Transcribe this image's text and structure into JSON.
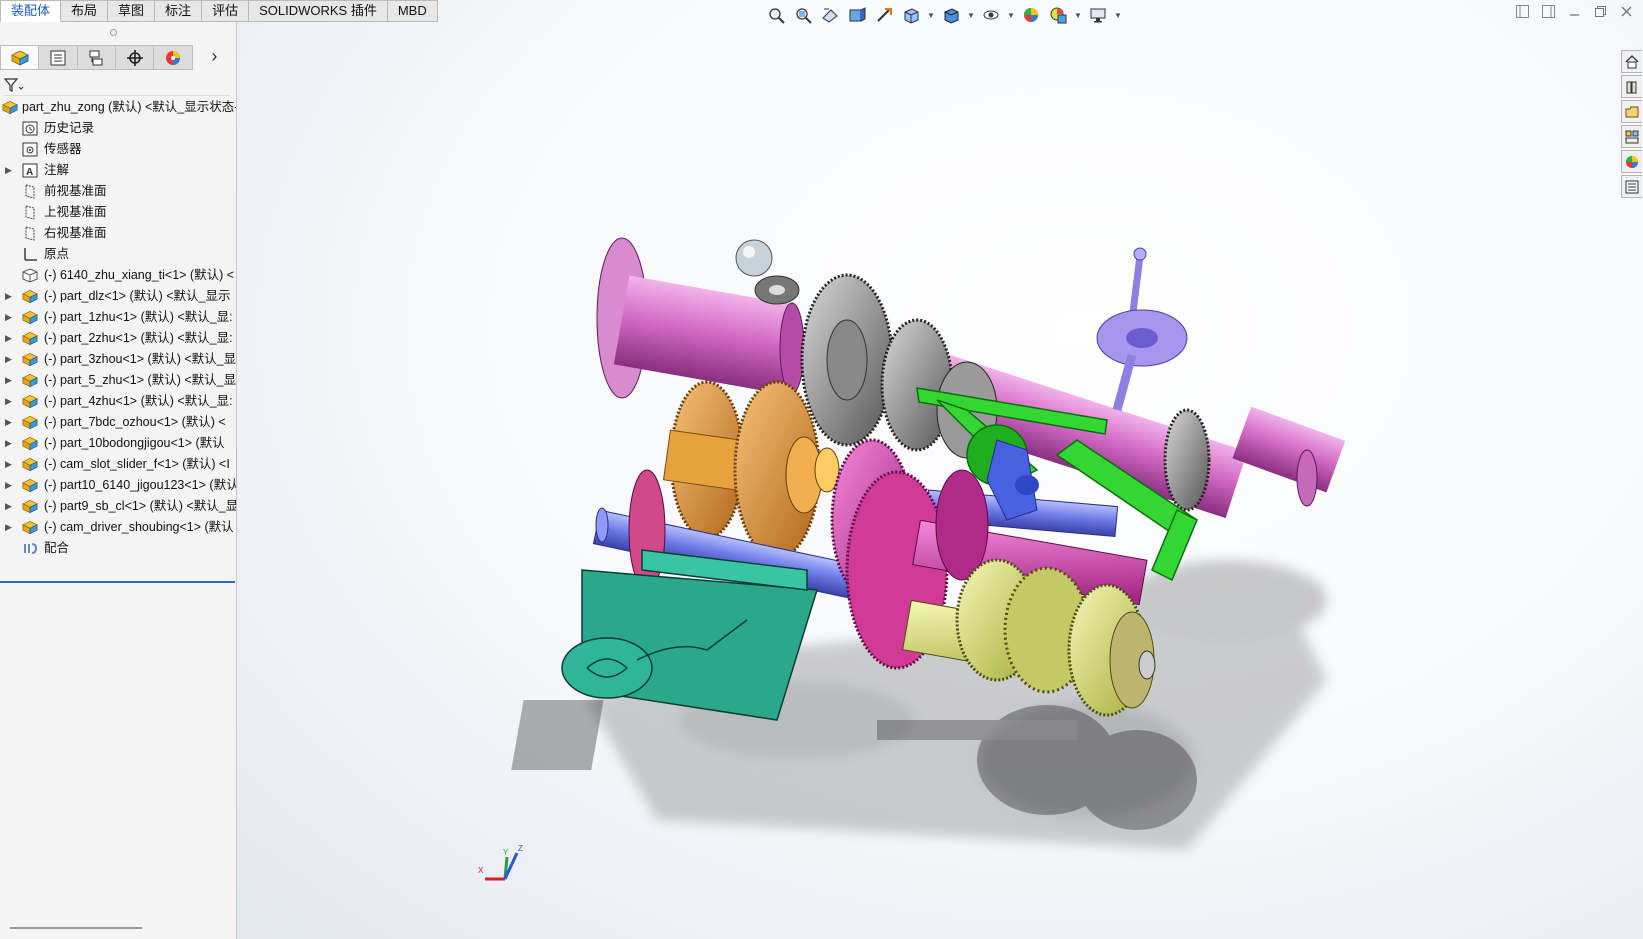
{
  "tabs": [
    "装配体",
    "布局",
    "草图",
    "标注",
    "评估",
    "SOLIDWORKS 插件",
    "MBD"
  ],
  "active_tab": "装配体",
  "manager_tabs": [
    "feature-manager",
    "property-manager",
    "configuration-manager",
    "dimxpert-manager",
    "display-manager"
  ],
  "tree": {
    "root": "part_zhu_zong  (默认) <默认_显示状态-",
    "items": [
      {
        "label": "历史记录",
        "icon": "history-icon",
        "expand": false
      },
      {
        "label": "传感器",
        "icon": "sensor-icon",
        "expand": false
      },
      {
        "label": "注解",
        "icon": "annotation-icon",
        "expand": true
      },
      {
        "label": "前视基准面",
        "icon": "plane-icon",
        "expand": false
      },
      {
        "label": "上视基准面",
        "icon": "plane-icon",
        "expand": false
      },
      {
        "label": "右视基准面",
        "icon": "plane-icon",
        "expand": false
      },
      {
        "label": "原点",
        "icon": "origin-icon",
        "expand": false
      },
      {
        "label": "(-) 6140_zhu_xiang_ti<1> (默认) <",
        "icon": "part-icon",
        "expand": false
      },
      {
        "label": "(-) part_dlz<1> (默认) <默认_显示",
        "icon": "subassembly-icon",
        "expand": true
      },
      {
        "label": "(-) part_1zhu<1> (默认) <默认_显:",
        "icon": "subassembly-icon",
        "expand": true
      },
      {
        "label": "(-) part_2zhu<1> (默认) <默认_显:",
        "icon": "subassembly-icon",
        "expand": true
      },
      {
        "label": "(-) part_3zhou<1> (默认) <默认_显",
        "icon": "subassembly-icon",
        "expand": true
      },
      {
        "label": "(-) part_5_zhu<1> (默认) <默认_显",
        "icon": "subassembly-icon",
        "expand": true
      },
      {
        "label": "(-) part_4zhu<1> (默认) <默认_显:",
        "icon": "subassembly-icon",
        "expand": true
      },
      {
        "label": "(-) part_7bdc_ozhou<1> (默认) <",
        "icon": "subassembly-icon",
        "expand": true
      },
      {
        "label": "(-) part_10bodongjigou<1> (默认",
        "icon": "subassembly-icon",
        "expand": true
      },
      {
        "label": "(-) cam_slot_slider_f<1> (默认) <I",
        "icon": "subassembly-icon",
        "expand": true
      },
      {
        "label": "(-) part10_6140_jigou123<1> (默认",
        "icon": "subassembly-icon",
        "expand": true
      },
      {
        "label": "(-) part9_sb_cl<1> (默认) <默认_显",
        "icon": "subassembly-icon",
        "expand": true
      },
      {
        "label": "(-) cam_driver_shoubing<1> (默认",
        "icon": "subassembly-icon",
        "expand": true
      },
      {
        "label": "配合",
        "icon": "mates-icon",
        "expand": false
      }
    ]
  },
  "hud_icons": [
    "zoom-to-fit-icon",
    "zoom-area-icon",
    "previous-view-icon",
    "section-view-icon",
    "dynamic-annotation-icon",
    "view-orientation-icon",
    "display-style-icon",
    "hide-show-icon",
    "edit-appearance-icon",
    "apply-scene-icon",
    "view-settings-icon"
  ],
  "task_pane_icons": [
    "home-icon",
    "design-library-icon",
    "file-explorer-icon",
    "view-palette-icon",
    "appearances-icon",
    "custom-properties-icon"
  ],
  "triad": {
    "x": "X",
    "y": "Y",
    "z": "Z"
  },
  "colors": {
    "accent": "#1e6ec8",
    "tab_active_text": "#1a5fb4"
  }
}
